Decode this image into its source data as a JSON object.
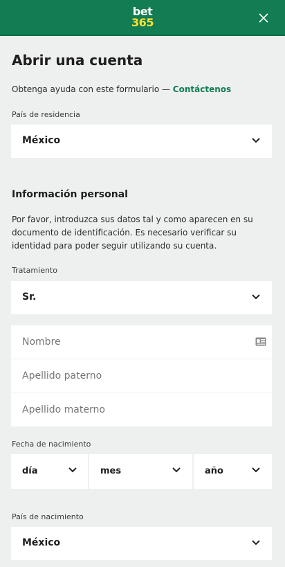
{
  "header": {
    "logo_line1": "bet",
    "logo_line2": "365",
    "brand_green": "#127d52",
    "brand_yellow": "#ffe033"
  },
  "form": {
    "title": "Abrir una cuenta",
    "help_text": "Obtenga ayuda con este formulario — ",
    "help_link": "Contáctenos",
    "residence_label": "País de residencia",
    "residence_value": "México",
    "personal_title": "Información personal",
    "personal_text": "Por favor, introduzca sus datos tal y como aparecen en su documento de identificación. Es necesario verificar su identidad para poder seguir utilizando su cuenta.",
    "title_label": "Tratamiento",
    "title_value": "Sr.",
    "name_placeholder": "Nombre",
    "paternal_placeholder": "Apellido paterno",
    "maternal_placeholder": "Apellido materno",
    "dob_label": "Fecha de nacimiento",
    "dob_day": "día",
    "dob_month": "mes",
    "dob_year": "año",
    "birth_country_label": "País de nacimiento",
    "birth_country_value": "México"
  }
}
